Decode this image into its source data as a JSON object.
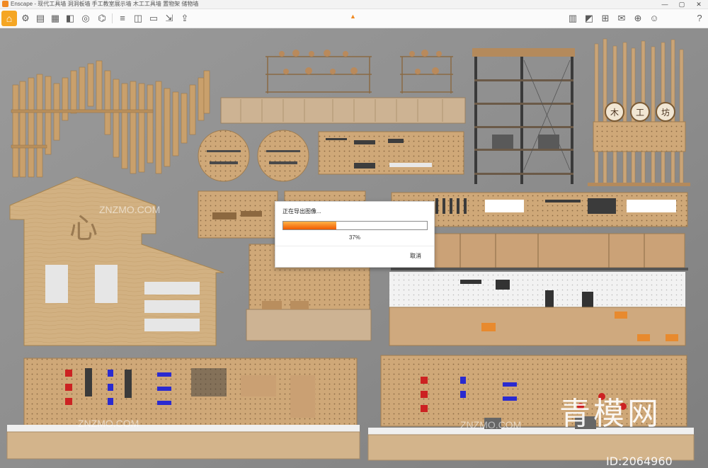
{
  "window": {
    "app_name": "Enscape",
    "title": "Enscape - 现代工具墙 洞洞板墙 手工教室展示墙 木工工具墙 置物架 储物墙",
    "controls": [
      "—",
      "▢",
      "✕"
    ]
  },
  "toolbar": {
    "buttons": [
      {
        "name": "home-button",
        "icon": "⌂"
      },
      {
        "name": "settings-button",
        "icon": "⚙"
      },
      {
        "name": "document-button",
        "icon": "▤"
      },
      {
        "name": "pdf-button",
        "icon": "▦"
      },
      {
        "name": "video-button",
        "icon": "◧"
      },
      {
        "name": "vr-button",
        "icon": "◎"
      },
      {
        "name": "asset-button",
        "icon": "⌬"
      },
      {
        "name": "layers-button",
        "icon": "≡"
      },
      {
        "name": "image-button",
        "icon": "◫"
      },
      {
        "name": "camera-button",
        "icon": "▭"
      },
      {
        "name": "export-button",
        "icon": "⇲"
      },
      {
        "name": "upload-button",
        "icon": "⇪"
      }
    ],
    "right_buttons": [
      {
        "name": "library-button",
        "icon": "▥"
      },
      {
        "name": "view-button",
        "icon": "◩"
      },
      {
        "name": "capture-button",
        "icon": "⊞"
      },
      {
        "name": "feedback-button",
        "icon": "✉"
      },
      {
        "name": "compass-button",
        "icon": "⊕"
      },
      {
        "name": "user-button",
        "icon": "☺"
      },
      {
        "name": "info-button",
        "icon": "?"
      }
    ]
  },
  "dialog": {
    "title": "正在导出图像...",
    "progress": 0.37,
    "progress_text": "37%",
    "cancel_label": "取消"
  },
  "watermark": {
    "brand": "青模网",
    "site": "ZNZMO.COM",
    "id": "ID:2064960"
  },
  "scene": {
    "sign_chars": [
      "木",
      "工",
      "坊"
    ],
    "house_char": "心"
  }
}
